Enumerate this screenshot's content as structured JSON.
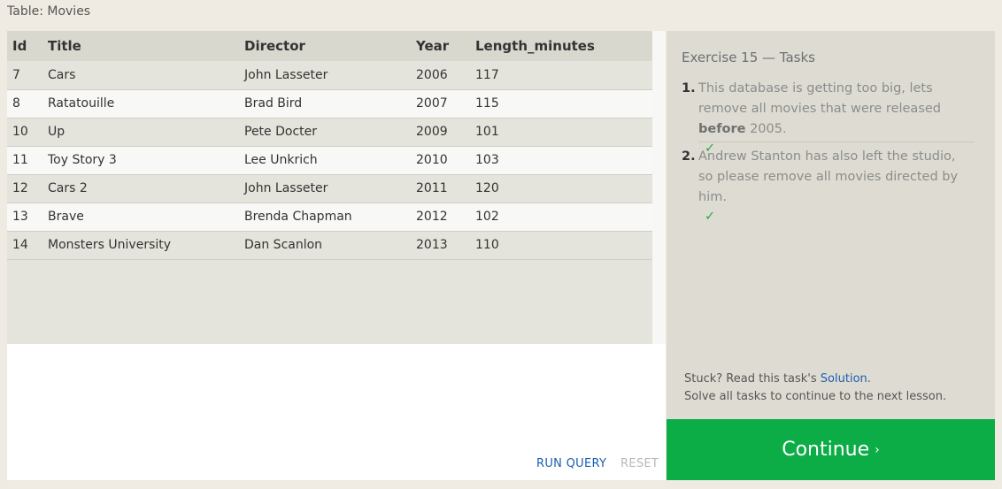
{
  "table_label": "Table: Movies",
  "table": {
    "columns": [
      "Id",
      "Title",
      "Director",
      "Year",
      "Length_minutes"
    ],
    "rows": [
      [
        "7",
        "Cars",
        "John Lasseter",
        "2006",
        "117"
      ],
      [
        "8",
        "Ratatouille",
        "Brad Bird",
        "2007",
        "115"
      ],
      [
        "10",
        "Up",
        "Pete Docter",
        "2009",
        "101"
      ],
      [
        "11",
        "Toy Story 3",
        "Lee Unkrich",
        "2010",
        "103"
      ],
      [
        "12",
        "Cars 2",
        "John Lasseter",
        "2011",
        "120"
      ],
      [
        "13",
        "Brave",
        "Brenda Chapman",
        "2012",
        "102"
      ],
      [
        "14",
        "Monsters University",
        "Dan Scanlon",
        "2013",
        "110"
      ]
    ]
  },
  "editor": {
    "run_label": "RUN QUERY",
    "reset_label": "RESET"
  },
  "exercise": {
    "title": "Exercise 15 — Tasks",
    "tasks": [
      {
        "number": "1.",
        "text_before": "This database is getting too big, lets remove all movies that were released ",
        "text_bold": "before",
        "text_after": " 2005.",
        "check": "✓"
      },
      {
        "number": "2.",
        "text": "Andrew Stanton has also left the studio, so please remove all movies directed by him.",
        "check": "✓"
      }
    ],
    "stuck_prefix": "Stuck? Read this task's ",
    "solution_link": "Solution",
    "stuck_suffix": ".",
    "solve_all": "Solve all tasks to continue to the next lesson."
  },
  "continue": {
    "label": "Continue",
    "chevron": "›"
  },
  "colors": {
    "accent_green": "#0cac47",
    "link_blue": "#1b5fb0",
    "check_green": "#2aa84a"
  }
}
